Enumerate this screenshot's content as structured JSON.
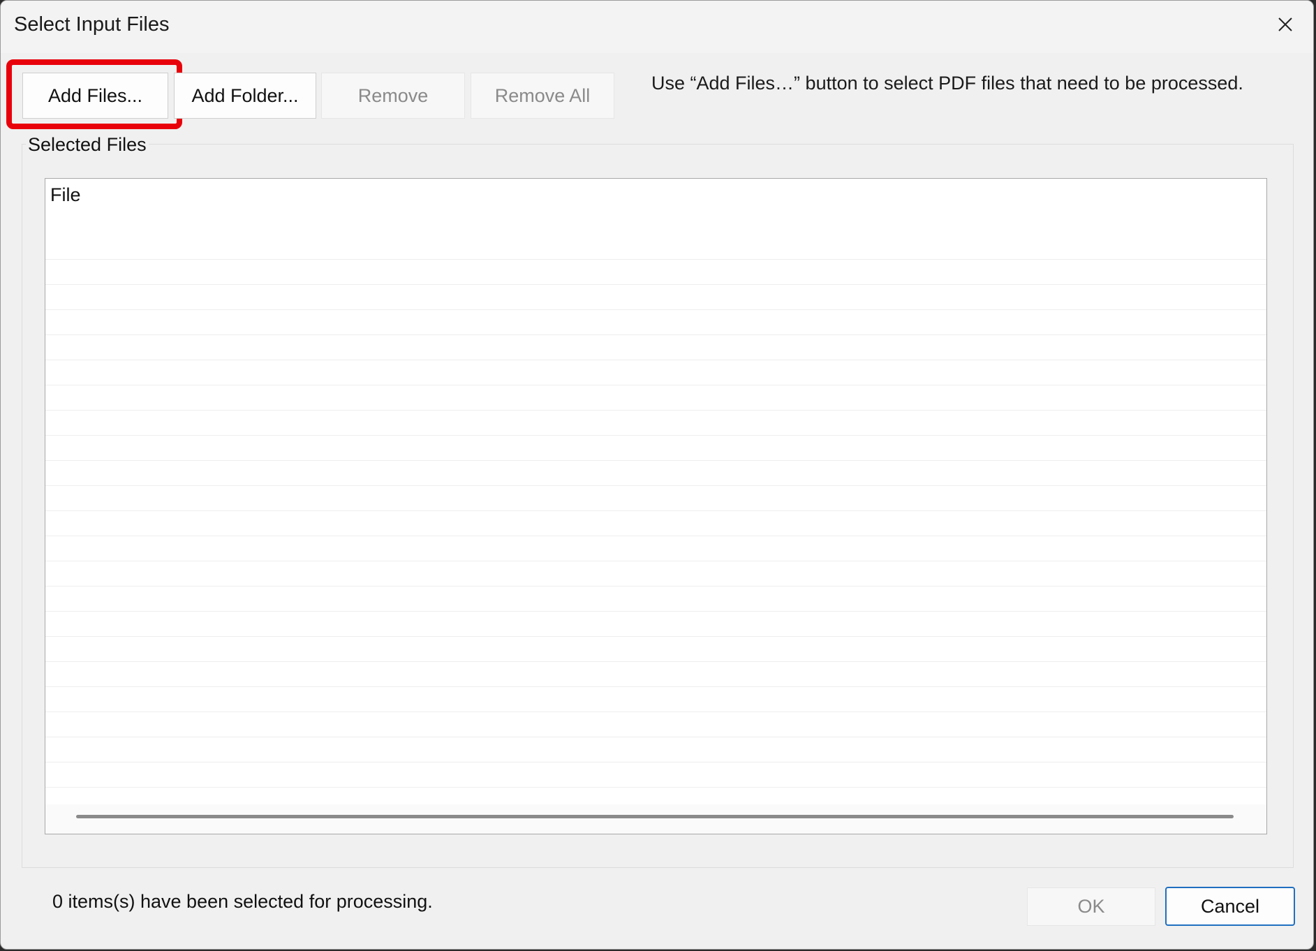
{
  "window": {
    "title": "Select Input Files",
    "close_icon": "close-icon"
  },
  "toolbar": {
    "add_files_label": "Add Files...",
    "add_folder_label": "Add Folder...",
    "remove_label": "Remove",
    "remove_all_label": "Remove All",
    "hint": "Use “Add Files…” button to select PDF files that need to be processed.",
    "highlight_color": "#e8000b"
  },
  "selected_files": {
    "group_label": "Selected Files",
    "columns": [
      "File"
    ],
    "rows": []
  },
  "footer": {
    "status": "0 items(s) have been selected for processing.",
    "ok_label": "OK",
    "cancel_label": "Cancel"
  }
}
